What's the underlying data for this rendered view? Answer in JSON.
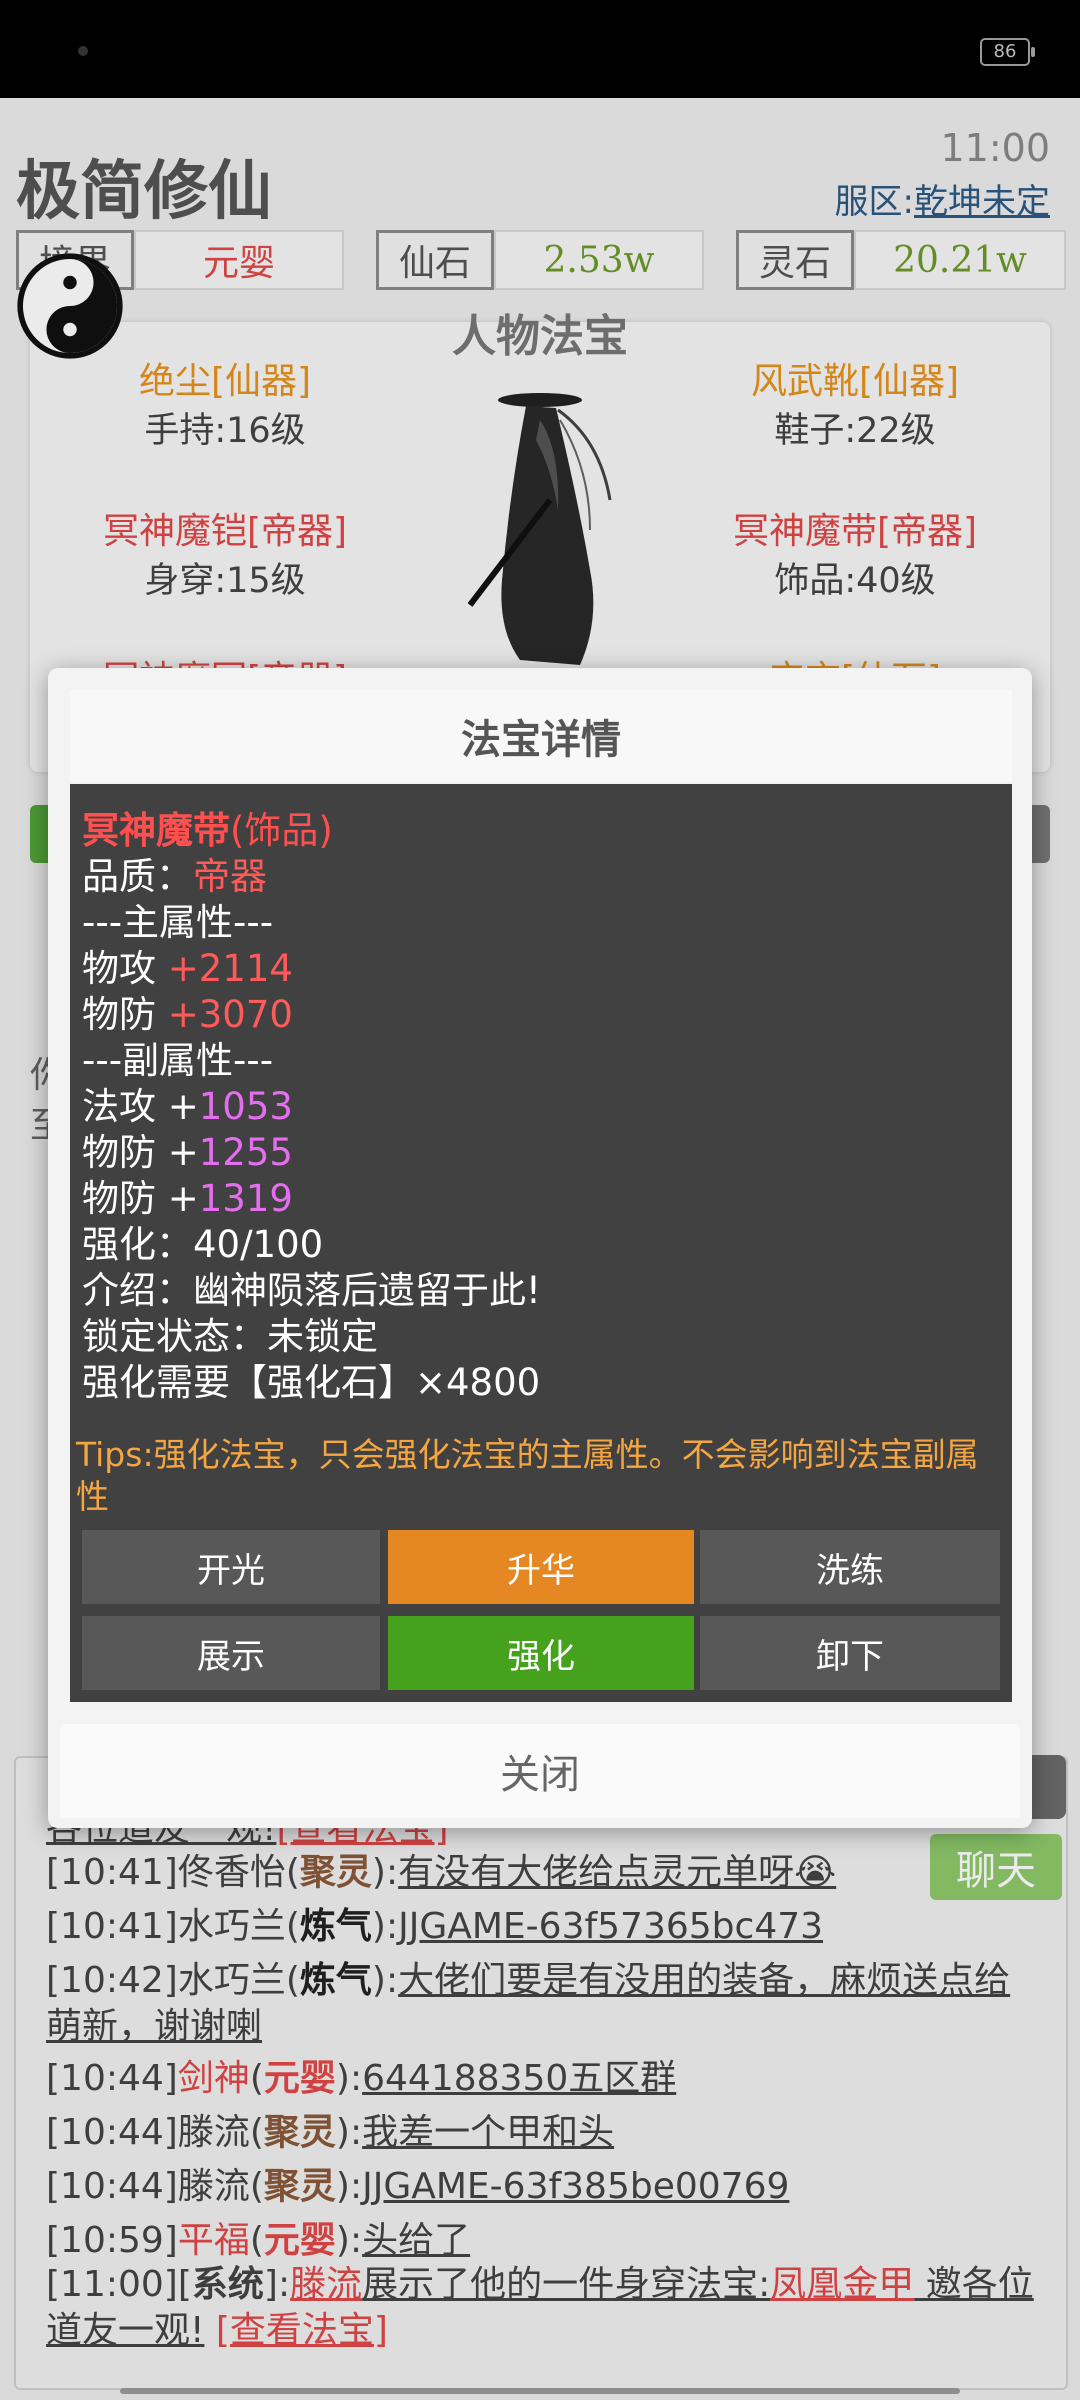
{
  "status_bar": {
    "battery": "86"
  },
  "header": {
    "app_title": "极简修仙",
    "clock": "11:00",
    "server_label": "服区:",
    "server_name": "乾坤未定"
  },
  "stats": {
    "realm_label": "境界",
    "realm_value": "元婴",
    "immortal_stone_label": "仙石",
    "immortal_stone_value": "2.53w",
    "spirit_stone_label": "灵石",
    "spirit_stone_value": "20.21w"
  },
  "equipment": {
    "title": "人物法宝",
    "items": [
      {
        "name": "绝尘[仙器]",
        "slot": "手持:16级"
      },
      {
        "name": "风武靴[仙器]",
        "slot": "鞋子:22级"
      },
      {
        "name": "冥神魔铠[帝器]",
        "slot": "身穿:15级"
      },
      {
        "name": "冥神魔带[帝器]",
        "slot": "饰品:40级"
      },
      {
        "name": "冥神魔冠[帝器]"
      },
      {
        "name": "宝玄[仙石]"
      }
    ]
  },
  "background_text": {
    "line1": "你",
    "line2": "至"
  },
  "modal": {
    "title": "法宝详情",
    "item_name": "冥神魔带",
    "item_type": "(饰品)",
    "quality_label": "品质：",
    "quality_value": "帝器",
    "main_header": "---主属性---",
    "main_attrs": [
      {
        "label": "物攻 ",
        "value": "+2114"
      },
      {
        "label": "物防 ",
        "value": "+3070"
      }
    ],
    "sub_header": "---副属性---",
    "sub_attrs": [
      {
        "label": "法攻 +",
        "value": "1053"
      },
      {
        "label": "物防 +",
        "value": "1255"
      },
      {
        "label": "物防 +",
        "value": "1319"
      }
    ],
    "enhance_line": "强化：40/100",
    "intro_line": "介绍：幽神陨落后遗留于此!",
    "lock_line": "锁定状态：未锁定",
    "requirement_line": "强化需要【强化石】×4800",
    "tips": "Tips:强化法宝，只会强化法宝的主属性。不会影响到法宝副属性",
    "buttons": {
      "kaiguang": "开光",
      "shenghua": "升华",
      "xilian": "洗练",
      "zhanshi": "展示",
      "qianghua": "强化",
      "xiexia": "卸下"
    },
    "close": "关闭"
  },
  "chat": {
    "button": "聊天",
    "partial_top": "各位道友一观!",
    "partial_top_link": "[查看法宝]",
    "lines": [
      {
        "time": "[10:41]",
        "user": "佟香怡",
        "realm": "聚灵",
        "msg": "有没有大佬给点灵元单呀😭"
      },
      {
        "time": "[10:41]",
        "user": "水巧兰",
        "realm": "炼气",
        "msg": "JJGAME-63f57365bc473"
      },
      {
        "time": "[10:42]",
        "user": "水巧兰",
        "realm": "炼气",
        "msg": "大佬们要是有没用的装备，麻烦送点给萌新，谢谢喇"
      },
      {
        "time": "[10:44]",
        "user": "剑神",
        "realm": "元婴",
        "msg": "644188350五区群"
      },
      {
        "time": "[10:44]",
        "user": "滕流",
        "realm": "聚灵",
        "msg": "我差一个甲和头"
      },
      {
        "time": "[10:44]",
        "user": "滕流",
        "realm": "聚灵",
        "msg": "JJGAME-63f385be00769"
      },
      {
        "time": "[10:59]",
        "user": "平福",
        "realm": "元婴",
        "msg": "头给了"
      }
    ],
    "system_line": {
      "time": "[11:00]",
      "tag": "系统",
      "user": "滕流",
      "text": "展示了他的一件身穿法宝:",
      "item": "凤凰金甲",
      "suffix": " 邀各位道友一观!",
      "link": "[查看法宝]"
    }
  }
}
